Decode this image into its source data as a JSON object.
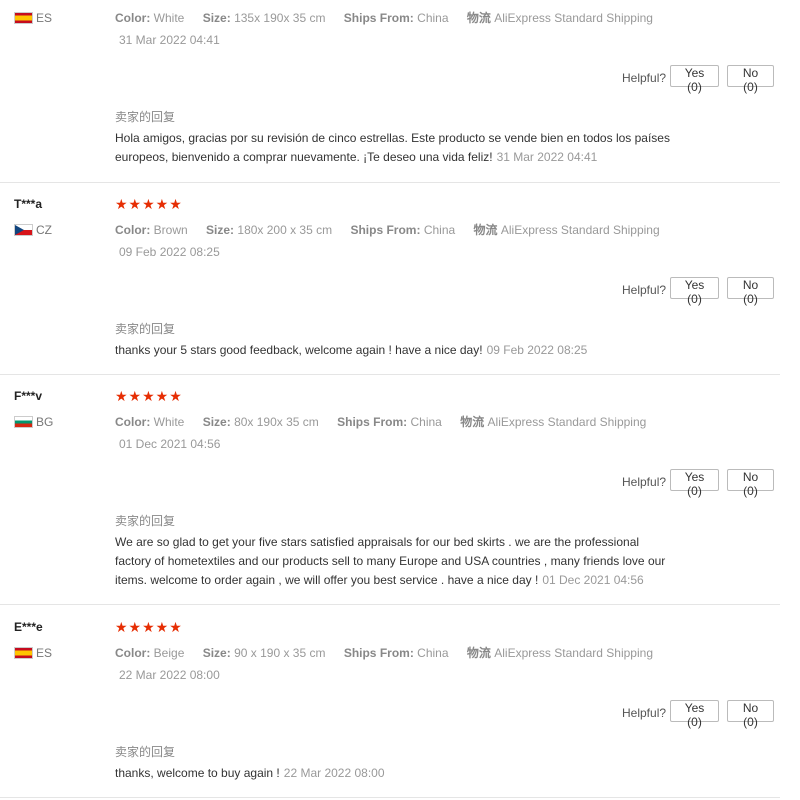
{
  "labels": {
    "color": "Color:",
    "size": "Size:",
    "ships_from": "Ships From:",
    "shipping_label": "物流",
    "helpful": "Helpful?",
    "yes": "Yes (0)",
    "no": "No (0)",
    "reply_title": "卖家的回复",
    "stars": "★★★★★"
  },
  "reviews": [
    {
      "name": "",
      "country": "ES",
      "flag": "flag-es",
      "color": "White",
      "size": "135x 190x 35 cm",
      "ships_from": "China",
      "shipping": "AliExpress Standard Shipping",
      "date": "31 Mar 2022 04:41",
      "reply": "Hola amigos, gracias por su revisión de cinco estrellas. Este producto se vende bien en todos los países europeos, bienvenido a comprar nuevamente. ¡Te deseo una vida feliz!",
      "reply_date": "31 Mar 2022 04:41"
    },
    {
      "name": "T***a",
      "country": "CZ",
      "flag": "flag-cz",
      "color": "Brown",
      "size": "180x 200 x 35 cm",
      "ships_from": "China",
      "shipping": "AliExpress Standard Shipping",
      "date": "09 Feb 2022 08:25",
      "reply": "thanks your 5 stars good feedback, welcome again ! have a nice day!",
      "reply_date": "09 Feb 2022 08:25"
    },
    {
      "name": "F***v",
      "country": "BG",
      "flag": "flag-bg",
      "color": "White",
      "size": "80x 190x 35 cm",
      "ships_from": "China",
      "shipping": "AliExpress Standard Shipping",
      "date": "01 Dec 2021 04:56",
      "reply": "We are so glad to get your five stars satisfied appraisals for our bed skirts . we are the professional factory of hometextiles and our products sell to many Europe and USA countries , many friends love our items. welcome to order again , we will offer you best service . have a nice day !",
      "reply_date": "01 Dec 2021 04:56"
    },
    {
      "name": "E***e",
      "country": "ES",
      "flag": "flag-es",
      "color": "Beige",
      "size": "90 x 190 x 35 cm",
      "ships_from": "China",
      "shipping": "AliExpress Standard Shipping",
      "date": "22 Mar 2022 08:00",
      "reply": "thanks, welcome to buy again !",
      "reply_date": "22 Mar 2022 08:00"
    }
  ]
}
